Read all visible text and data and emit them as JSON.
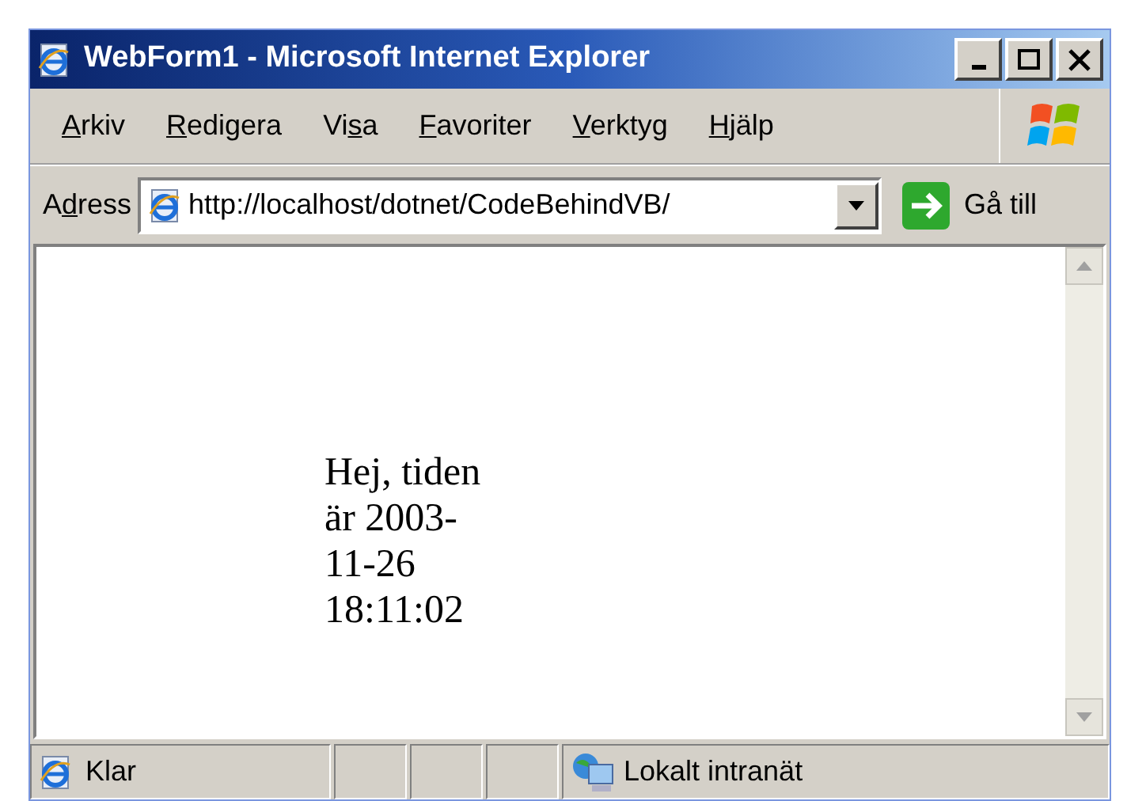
{
  "window": {
    "title": "WebForm1 - Microsoft Internet Explorer"
  },
  "menu": [
    {
      "key": "A",
      "post": "rkiv"
    },
    {
      "key": "R",
      "post": "edigera"
    },
    {
      "pre": "Vi",
      "key": "s",
      "post": "a"
    },
    {
      "key": "F",
      "post": "avoriter"
    },
    {
      "key": "V",
      "post": "erktyg"
    },
    {
      "key": "H",
      "post": "jälp"
    }
  ],
  "address": {
    "label_pre": "A",
    "label_key": "d",
    "label_post": "ress",
    "value": "http://localhost/dotnet/CodeBehindVB/",
    "go": "Gå till"
  },
  "page": {
    "text": "Hej, tiden är 2003-11-26 18:11:02"
  },
  "status_bar": {
    "text": "Klar",
    "zone": "Lokalt intranät"
  }
}
